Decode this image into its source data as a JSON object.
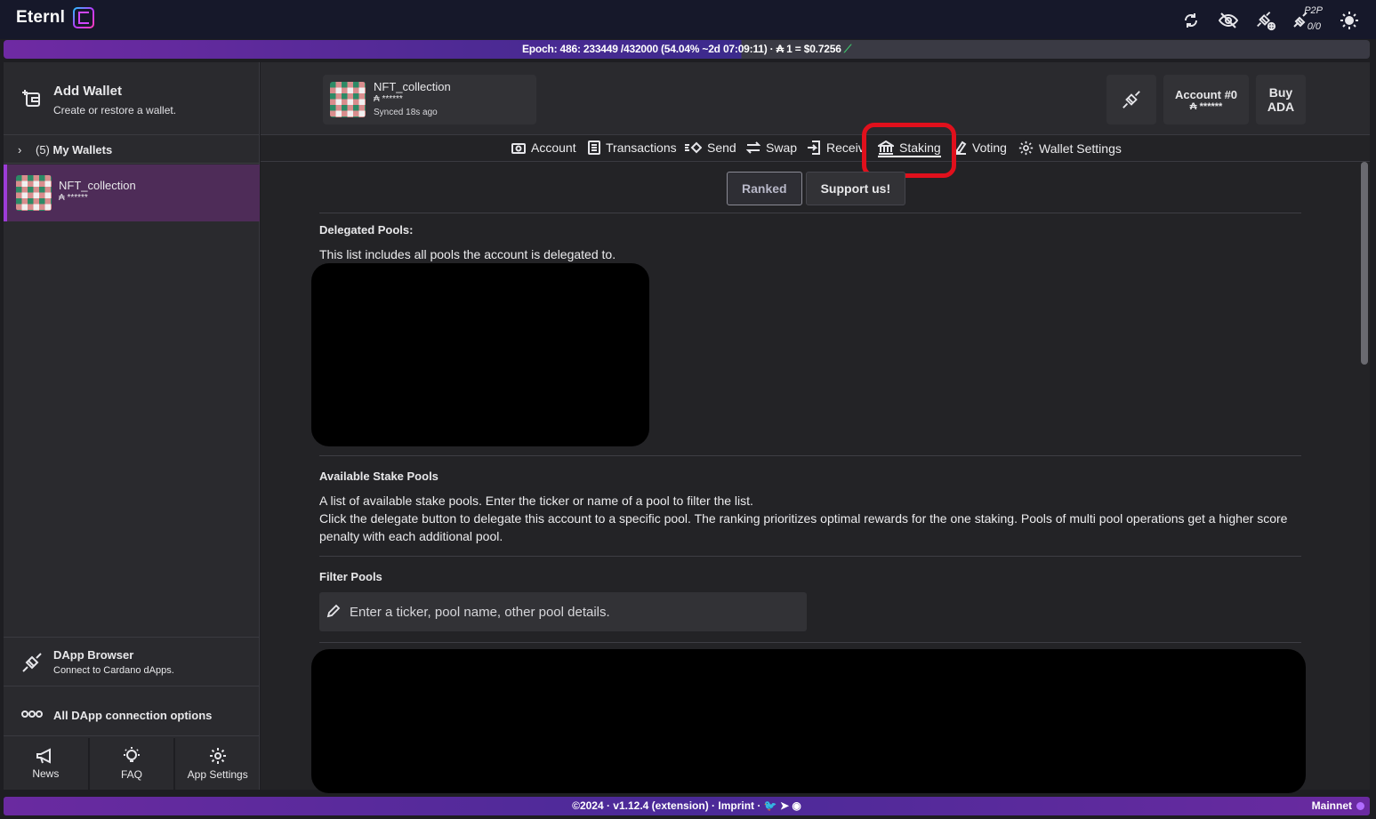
{
  "app": {
    "name": "Eternl"
  },
  "topbar": {
    "p2p_label": "P2P",
    "p2p_count": "0/0"
  },
  "epoch": {
    "text_main": "Epoch: 486: 233449 /432000 (54.04%  ~2d 07:09:11) · ₳ 1 = $0.7256",
    "trend_icon": "trend-up"
  },
  "sidebar": {
    "add_wallet": {
      "title": "Add Wallet",
      "subtitle": "Create or restore a wallet."
    },
    "my_wallets": {
      "count": "(5)",
      "label": "My Wallets"
    },
    "wallets": [
      {
        "name": "NFT_collection",
        "balance": "₳ ******"
      }
    ],
    "dapp_browser": {
      "title": "DApp Browser",
      "subtitle": "Connect to Cardano dApps."
    },
    "dapp_all": {
      "title": "All DApp connection options"
    },
    "bottom_nav": [
      {
        "label": "News"
      },
      {
        "label": "FAQ"
      },
      {
        "label": "App Settings"
      }
    ]
  },
  "header": {
    "wallet": {
      "name": "NFT_collection",
      "balance": "₳ ******",
      "synced": "Synced 18s ago"
    },
    "account": {
      "label": "Account #0",
      "balance": "₳ ******"
    },
    "buy": {
      "line1": "Buy",
      "line2": "ADA"
    }
  },
  "tabs": [
    {
      "label": "Account",
      "icon": "camera-icon"
    },
    {
      "label": "Transactions",
      "icon": "list-icon"
    },
    {
      "label": "Send",
      "icon": "send-icon"
    },
    {
      "label": "Swap",
      "icon": "swap-icon"
    },
    {
      "label": "Receiv",
      "icon": "receive-icon"
    },
    {
      "label": "Staking",
      "icon": "bank-icon",
      "active": true
    },
    {
      "label": "Voting",
      "icon": "vote-icon"
    },
    {
      "label": "Wallet Settings",
      "icon": "gear-icon"
    }
  ],
  "staking": {
    "buttons": {
      "ranked": "Ranked",
      "support": "Support us!"
    },
    "delegated": {
      "title": "Delegated Pools:",
      "desc": "This list includes all pools the account is delegated to."
    },
    "available": {
      "title": "Available Stake Pools",
      "desc1": "A list of available stake pools. Enter the ticker or name of a pool to filter the list.",
      "desc2": "Click the delegate button to delegate this account to a specific pool. The ranking prioritizes optimal rewards for the one staking. Pools of multi pool operations get a higher score penalty with each additional pool."
    },
    "filter": {
      "title": "Filter Pools",
      "placeholder": "Enter a ticker, pool name, other pool details."
    }
  },
  "footer": {
    "text": "©2024 · v1.12.4 (extension) · Imprint ·",
    "network": "Mainnet"
  },
  "colors": {
    "accent": "#9c3cd8",
    "highlight": "#e0101c",
    "trend": "#3fc46d"
  }
}
